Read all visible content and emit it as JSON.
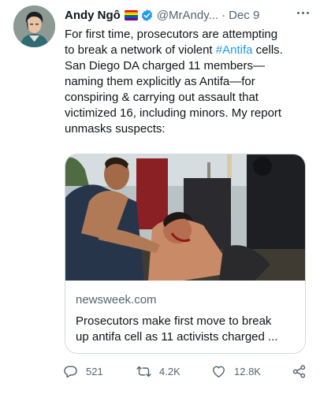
{
  "author": {
    "name": "Andy Ngô",
    "handle": "@MrAndy...",
    "date": "Dec 9",
    "avatar_icon": "user-avatar"
  },
  "tweet": {
    "lines": [
      {
        "text": "For first time, prosecutors are attempting"
      },
      {
        "pre": "to break a network of violent ",
        "hashtag": "#Antifa",
        "post": " cells."
      },
      {
        "text": "San Diego DA charged 11 members—"
      },
      {
        "text": "naming them explicitly as Antifa—for"
      },
      {
        "text": "conspiring & carrying out assault that"
      },
      {
        "text": "victimized 16, including minors. My report"
      },
      {
        "text": "unmasks suspects:"
      }
    ]
  },
  "link_card": {
    "domain": "newsweek.com",
    "title_line1": "Prosecutors make first move to break",
    "title_line2": "up antifa cell as 11 activists charged ..."
  },
  "actions": {
    "reply_count": "521",
    "retweet_count": "4.2K",
    "like_count": "12.8K"
  },
  "colors": {
    "accent": "#1d9bf0",
    "text_primary": "#0f1419",
    "text_secondary": "#536471",
    "border": "#cfd9de"
  }
}
